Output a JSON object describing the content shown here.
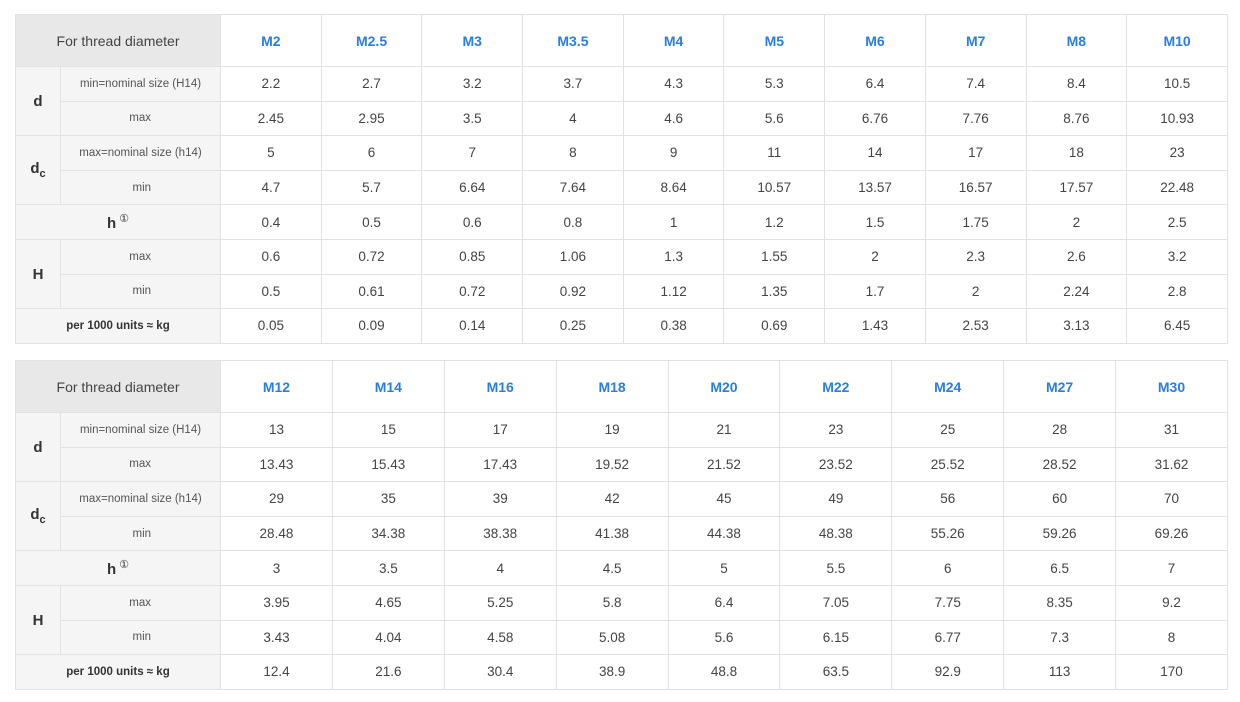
{
  "labels": {
    "header": "For thread diameter",
    "d": "d",
    "dc_main": "d",
    "dc_sub": "c",
    "h": "h",
    "h_note": "①",
    "H": "H",
    "d_min": "min=nominal size (H14)",
    "d_max": "max",
    "dc_max": "max=nominal size (h14)",
    "dc_min": "min",
    "H_max": "max",
    "H_min": "min",
    "weight": "per 1000 units ≈ kg"
  },
  "tables": [
    {
      "sizes": [
        "M2",
        "M2.5",
        "M3",
        "M3.5",
        "M4",
        "M5",
        "M6",
        "M7",
        "M8",
        "M10"
      ],
      "d_min": [
        "2.2",
        "2.7",
        "3.2",
        "3.7",
        "4.3",
        "5.3",
        "6.4",
        "7.4",
        "8.4",
        "10.5"
      ],
      "d_max": [
        "2.45",
        "2.95",
        "3.5",
        "4",
        "4.6",
        "5.6",
        "6.76",
        "7.76",
        "8.76",
        "10.93"
      ],
      "dc_max": [
        "5",
        "6",
        "7",
        "8",
        "9",
        "11",
        "14",
        "17",
        "18",
        "23"
      ],
      "dc_min": [
        "4.7",
        "5.7",
        "6.64",
        "7.64",
        "8.64",
        "10.57",
        "13.57",
        "16.57",
        "17.57",
        "22.48"
      ],
      "h": [
        "0.4",
        "0.5",
        "0.6",
        "0.8",
        "1",
        "1.2",
        "1.5",
        "1.75",
        "2",
        "2.5"
      ],
      "H_max": [
        "0.6",
        "0.72",
        "0.85",
        "1.06",
        "1.3",
        "1.55",
        "2",
        "2.3",
        "2.6",
        "3.2"
      ],
      "H_min": [
        "0.5",
        "0.61",
        "0.72",
        "0.92",
        "1.12",
        "1.35",
        "1.7",
        "2",
        "2.24",
        "2.8"
      ],
      "weight": [
        "0.05",
        "0.09",
        "0.14",
        "0.25",
        "0.38",
        "0.69",
        "1.43",
        "2.53",
        "3.13",
        "6.45"
      ]
    },
    {
      "sizes": [
        "M12",
        "M14",
        "M16",
        "M18",
        "M20",
        "M22",
        "M24",
        "M27",
        "M30"
      ],
      "d_min": [
        "13",
        "15",
        "17",
        "19",
        "21",
        "23",
        "25",
        "28",
        "31"
      ],
      "d_max": [
        "13.43",
        "15.43",
        "17.43",
        "19.52",
        "21.52",
        "23.52",
        "25.52",
        "28.52",
        "31.62"
      ],
      "dc_max": [
        "29",
        "35",
        "39",
        "42",
        "45",
        "49",
        "56",
        "60",
        "70"
      ],
      "dc_min": [
        "28.48",
        "34.38",
        "38.38",
        "41.38",
        "44.38",
        "48.38",
        "55.26",
        "59.26",
        "69.26"
      ],
      "h": [
        "3",
        "3.5",
        "4",
        "4.5",
        "5",
        "5.5",
        "6",
        "6.5",
        "7"
      ],
      "H_max": [
        "3.95",
        "4.65",
        "5.25",
        "5.8",
        "6.4",
        "7.05",
        "7.75",
        "8.35",
        "9.2"
      ],
      "H_min": [
        "3.43",
        "4.04",
        "4.58",
        "5.08",
        "5.6",
        "6.15",
        "6.77",
        "7.3",
        "8"
      ],
      "weight": [
        "12.4",
        "21.6",
        "30.4",
        "38.9",
        "48.8",
        "63.5",
        "92.9",
        "113",
        "170"
      ]
    }
  ]
}
